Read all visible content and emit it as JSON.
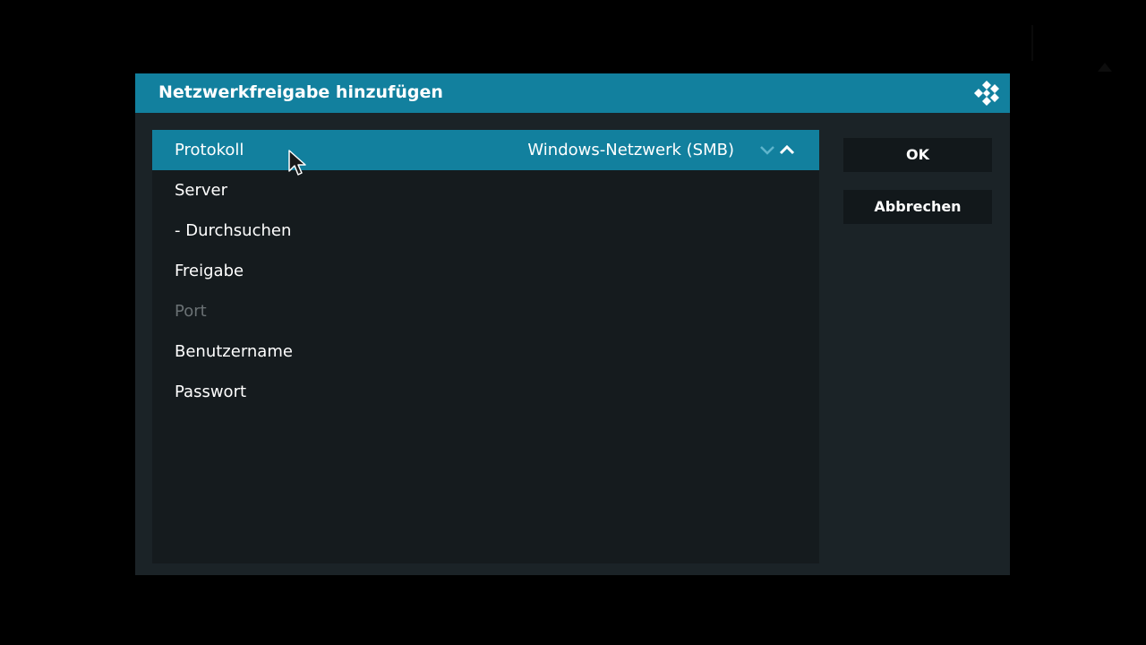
{
  "dialog": {
    "title": "Netzwerkfreigabe hinzufügen",
    "logo_icon": "kodi-logo-icon"
  },
  "settings_list": {
    "rows": [
      {
        "label": "Protokoll",
        "value": "Windows-Netzwerk (SMB)",
        "selected": true,
        "enabled": true
      },
      {
        "label": "Server",
        "value": "",
        "selected": false,
        "enabled": true
      },
      {
        "label": "- Durchsuchen",
        "value": "",
        "selected": false,
        "enabled": true
      },
      {
        "label": "Freigabe",
        "value": "",
        "selected": false,
        "enabled": true
      },
      {
        "label": "Port",
        "value": "",
        "selected": false,
        "enabled": false
      },
      {
        "label": "Benutzername",
        "value": "",
        "selected": false,
        "enabled": true
      },
      {
        "label": "Passwort",
        "value": "",
        "selected": false,
        "enabled": true
      }
    ]
  },
  "buttons": {
    "ok_label": "OK",
    "cancel_label": "Abbrechen"
  },
  "colors": {
    "accent": "#12809e",
    "dialog_bg": "#1b2327",
    "list_bg": "#151b1e",
    "button_bg": "#12181b",
    "disabled_text": "#6a7174"
  }
}
